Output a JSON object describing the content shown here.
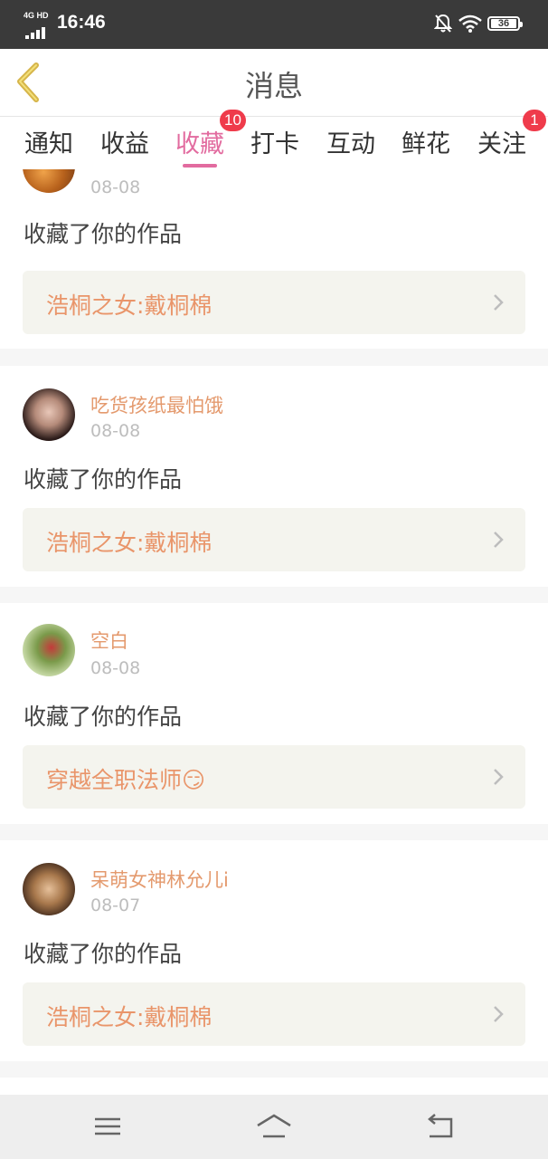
{
  "status_bar": {
    "network": "4G HD",
    "time": "16:46",
    "battery": "36",
    "icons": [
      "signal-icon",
      "bell-off-icon",
      "wifi-icon",
      "battery-icon"
    ]
  },
  "header": {
    "title": "消息",
    "back_icon": "chevron-left-icon"
  },
  "tabs": [
    {
      "label": "通知",
      "badge": null
    },
    {
      "label": "收益",
      "badge": null
    },
    {
      "label": "收藏",
      "badge": "10",
      "active": true
    },
    {
      "label": "打卡",
      "badge": null
    },
    {
      "label": "互动",
      "badge": null
    },
    {
      "label": "鲜花",
      "badge": null
    },
    {
      "label": "关注",
      "badge": "1"
    }
  ],
  "messages": [
    {
      "username": "",
      "date": "08-08",
      "action": "收藏了你的作品",
      "work": "浩桐之女:戴桐棉",
      "avatar": "avatar-1"
    },
    {
      "username": "吃货孩纸最怕饿",
      "date": "08-08",
      "action": "收藏了你的作品",
      "work": "浩桐之女:戴桐棉",
      "avatar": "avatar-2"
    },
    {
      "username": "空白",
      "date": "08-08",
      "action": "收藏了你的作品",
      "work": "穿越全职法师😏",
      "avatar": "avatar-3"
    },
    {
      "username": "呆萌女神林允儿i",
      "date": "08-07",
      "action": "收藏了你的作品",
      "work": "浩桐之女:戴桐棉",
      "avatar": "avatar-4"
    }
  ],
  "colors": {
    "accent_pink": "#e26b9f",
    "username_orange": "#e49a6e",
    "work_title_orange": "#e9956a",
    "badge_red": "#ef3b4b"
  },
  "navbar": [
    "menu-icon",
    "home-icon",
    "back-icon"
  ]
}
